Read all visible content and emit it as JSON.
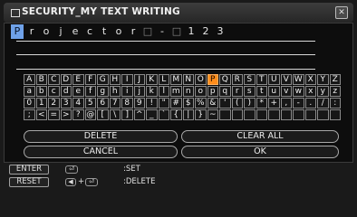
{
  "window": {
    "title": "SECURITY_MY TEXT WRITING"
  },
  "entry": {
    "chars": [
      {
        "c": "P",
        "cursor": true
      },
      {
        "c": "r"
      },
      {
        "c": "o"
      },
      {
        "c": "j"
      },
      {
        "c": "e"
      },
      {
        "c": "c"
      },
      {
        "c": "t"
      },
      {
        "c": "o"
      },
      {
        "c": "r"
      },
      {
        "c": "□",
        "blank": true
      },
      {
        "c": "-"
      },
      {
        "c": "□",
        "blank": true
      },
      {
        "c": "1"
      },
      {
        "c": "2"
      },
      {
        "c": "3"
      }
    ]
  },
  "keyboard": {
    "selected_key": "P",
    "rows": [
      [
        "A",
        "B",
        "C",
        "D",
        "E",
        "F",
        "G",
        "H",
        "I",
        "J",
        "K",
        "L",
        "M",
        "N",
        "O",
        "P",
        "Q",
        "R",
        "S",
        "T",
        "U",
        "V",
        "W",
        "X",
        "Y",
        "Z"
      ],
      [
        "a",
        "b",
        "c",
        "d",
        "e",
        "f",
        "g",
        "h",
        "i",
        "j",
        "k",
        "l",
        "m",
        "n",
        "o",
        "p",
        "q",
        "r",
        "s",
        "t",
        "u",
        "v",
        "w",
        "x",
        "y",
        "z"
      ],
      [
        "0",
        "1",
        "2",
        "3",
        "4",
        "5",
        "6",
        "7",
        "8",
        "9",
        "!",
        "\"",
        "#",
        "$",
        "%",
        "&",
        "'",
        "(",
        ")",
        "*",
        "+",
        ",",
        "-",
        ".",
        "/",
        ":"
      ],
      [
        ";",
        "<",
        "=",
        ">",
        "?",
        "@",
        "[",
        "\\",
        "]",
        "^",
        "_",
        "`",
        "{",
        "|",
        "}",
        "~",
        " ",
        " ",
        " ",
        " ",
        " ",
        " ",
        " ",
        " ",
        " ",
        " "
      ]
    ]
  },
  "buttons": {
    "delete": "DELETE",
    "clear_all": "CLEAR ALL",
    "cancel": "CANCEL",
    "ok": "OK"
  },
  "footer": {
    "enter_label": "ENTER",
    "set_text": ":SET",
    "reset_label": "RESET",
    "delete_text": ":DELETE",
    "plus": "+"
  },
  "colors": {
    "cursor": "#6fa1e8",
    "selected_key": "#ff8c1a"
  }
}
